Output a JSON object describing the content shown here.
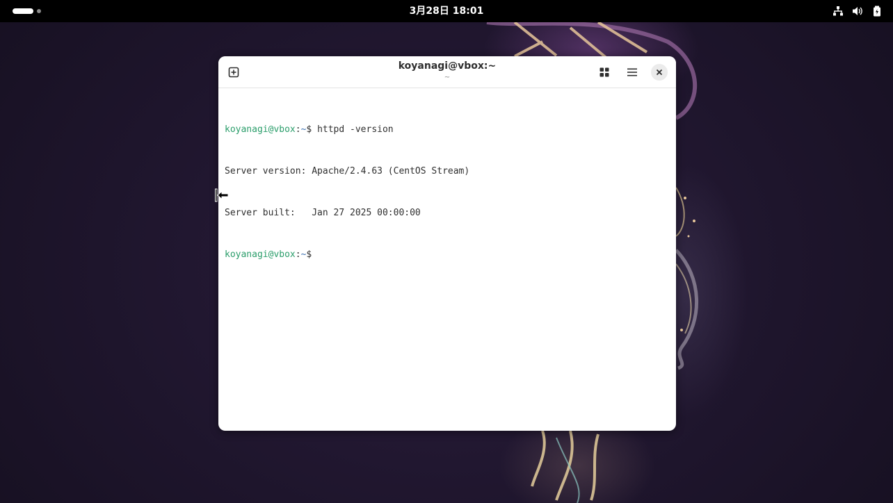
{
  "topbar": {
    "clock": "3月28日 18:01",
    "tray_icons": [
      "network-wired-icon",
      "volume-icon",
      "battery-icon"
    ]
  },
  "terminal_window": {
    "title": "koyanagi@vbox:~",
    "subtitle": "~",
    "lines": [
      {
        "type": "prompt",
        "user": "koyanagi@vbox",
        "sep": ":",
        "path": "~",
        "symbol": "$ ",
        "command": "httpd -version"
      },
      {
        "type": "output",
        "text": "Server version: Apache/2.4.63 (CentOS Stream)"
      },
      {
        "type": "output",
        "text": "Server built:   Jan 27 2025 00:00:00"
      },
      {
        "type": "prompt",
        "user": "koyanagi@vbox",
        "sep": ":",
        "path": "~",
        "symbol": "$",
        "command": ""
      }
    ]
  },
  "colors": {
    "topbar_bg": "#000000",
    "prompt_user": "#2a9d6a",
    "prompt_path": "#3a6fb0",
    "terminal_bg": "#ffffff"
  }
}
